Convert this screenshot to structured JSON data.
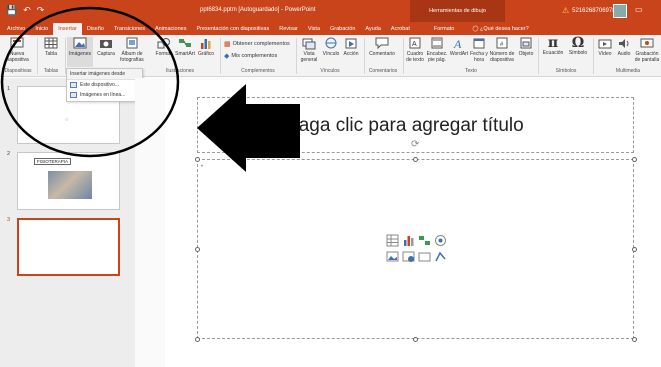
{
  "window": {
    "title": "ppt6834.pptm [Autoguardado] - PowerPoint",
    "tools_tab": "Herramientas de dibujo",
    "user": "5216268706978"
  },
  "tabs": [
    {
      "label": "Archivo"
    },
    {
      "label": "Inicio"
    },
    {
      "label": "Insertar"
    },
    {
      "label": "Diseño"
    },
    {
      "label": "Transiciones"
    },
    {
      "label": "Animaciones"
    },
    {
      "label": "Presentación con diapositivas"
    },
    {
      "label": "Revisar"
    },
    {
      "label": "Vista"
    },
    {
      "label": "Grabación"
    },
    {
      "label": "Ayuda"
    },
    {
      "label": "Acrobat"
    },
    {
      "label": "Formato"
    },
    {
      "label": "¿Qué desea hacer?"
    }
  ],
  "ribbon": {
    "nueva_diapositiva": "Nueva diapositiva",
    "tabla": "Tabla",
    "imagenes": "Imágenes",
    "captura": "Captura",
    "album": "Álbum de fotografías",
    "formas": "Formas",
    "smartart": "SmartArt",
    "grafico": "Gráfico",
    "obtener": "Obtener complementos",
    "mis": "Mis complementos",
    "vista_general": "Vista general",
    "vinculo": "Vínculo",
    "accion": "Acción",
    "comentario": "Comentario",
    "cuadro": "Cuadro de texto",
    "encabez": "Encabez. pie pág.",
    "wordart": "WordArt",
    "fecha": "Fecha y hora",
    "numero": "Número de diapositiva",
    "objeto": "Objeto",
    "ecuacion": "Ecuación",
    "simbolo": "Símbolo",
    "video": "Vídeo",
    "audio": "Audio",
    "grabacion": "Grabación de pantalla",
    "groups": {
      "diapositivas": "Diapositivas",
      "tablas": "Tablas",
      "ilustraciones": "Ilustraciones",
      "complementos": "Complementos",
      "vinculos": "Vínculos",
      "comentarios": "Comentarios",
      "texto": "Texto",
      "simbolos": "Símbolos",
      "multimedia": "Multimedia"
    }
  },
  "dropdown": {
    "header": "Insertar imágenes desde",
    "items": [
      {
        "label": "Este dispositivo..."
      },
      {
        "label": "Imágenes en línea..."
      }
    ]
  },
  "thumbnails": [
    {
      "number": "1"
    },
    {
      "number": "2",
      "caption": "FISIOTERAPIA"
    },
    {
      "number": "3"
    }
  ],
  "slide": {
    "title_placeholder": "Haga clic para agregar título"
  },
  "colors": {
    "accent": "#c9441a",
    "ribbon_bg": "#f3f3f3"
  }
}
